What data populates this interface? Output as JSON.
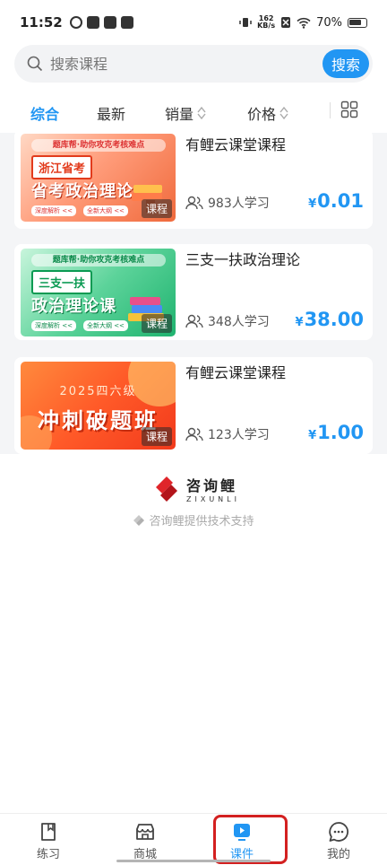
{
  "status_bar": {
    "time": "11:52",
    "speed_value": "162",
    "speed_unit": "KB/s",
    "battery": "70%"
  },
  "search": {
    "placeholder": "搜索课程",
    "button_label": "搜索"
  },
  "sort_bar": {
    "items": [
      "综合",
      "最新",
      "销量",
      "价格"
    ],
    "active": "综合"
  },
  "courses": [
    {
      "title": "有鲤云课堂课程",
      "students": "983人学习",
      "currency": "¥",
      "price": "0.01",
      "tag": "课程",
      "thumb": {
        "top": "题库帮·助你攻克考核难点",
        "label": "浙江省考",
        "main": "省考政治理论",
        "sub": [
          "深度解析 <<",
          "全新大纲 <<"
        ]
      }
    },
    {
      "title": "三支一扶政治理论",
      "students": "348人学习",
      "currency": "¥",
      "price": "38.00",
      "tag": "课程",
      "thumb": {
        "top": "题库帮·助你攻克考核难点",
        "label": "三支一扶",
        "main": "政治理论课",
        "sub": [
          "深度解析 <<",
          "全新大纲 <<"
        ]
      }
    },
    {
      "title": "有鲤云课堂课程",
      "students": "123人学习",
      "currency": "¥",
      "price": "1.00",
      "tag": "课程",
      "thumb": {
        "year": "2025四六级",
        "main": "冲刺破题班"
      }
    }
  ],
  "brand": {
    "name_cn": "咨询鲤",
    "name_en": "ZIXUNLI",
    "support": "咨询鲤提供技术支持"
  },
  "tabbar": {
    "items": [
      "练习",
      "商城",
      "课件",
      "我的"
    ],
    "active": "课件"
  },
  "colors": {
    "accent": "#2196f3",
    "highlight": "#d32020"
  }
}
